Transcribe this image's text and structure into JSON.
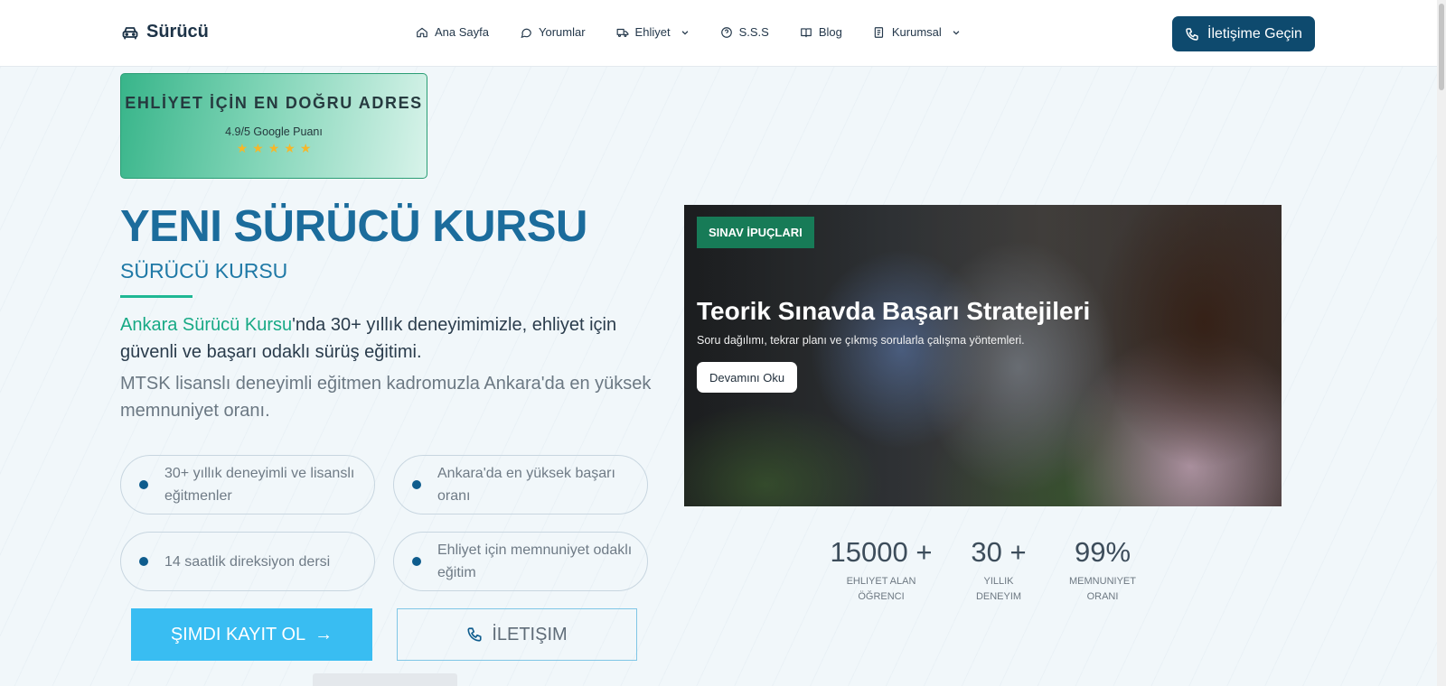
{
  "header": {
    "brand": "Sürücü",
    "nav": [
      {
        "label": "Ana Sayfa"
      },
      {
        "label": "Yorumlar"
      },
      {
        "label": "Ehliyet"
      },
      {
        "label": "S.S.S"
      },
      {
        "label": "Blog"
      },
      {
        "label": "Kurumsal"
      }
    ],
    "cta_label": "İletişime Geçin"
  },
  "badge": {
    "title": "EHLİYET İÇİN EN DOĞRU ADRES",
    "score": "4.9/5 Google Puanı",
    "stars": 5
  },
  "hero": {
    "title": "YENI SÜRÜCÜ KURSU",
    "subtitle": "SÜRÜCÜ KURSU",
    "p1_highlight": "Ankara Sürücü Kursu",
    "p1_rest": "'nda 30+ yıllık deneyimimizle, ehliyet için güvenli ve başarı odaklı sürüş eğitimi.",
    "p2": "MTSK lisanslı deneyimli eğitmen kadromuzla Ankara'da en yüksek memnuniyet oranı."
  },
  "features": [
    "30+ yıllık deneyimli ve lisanslı eğitmenler",
    "Ankara'da en yüksek başarı oranı",
    "14 saatlik direksiyon dersi",
    "Ehliyet için memnuniyet odaklı eğitim"
  ],
  "buttons": {
    "register": "ŞIMDI KAYIT OL",
    "contact": "İLETIŞIM"
  },
  "article": {
    "tag": "SINAV İPUÇLARI",
    "title": "Teorik Sınavda Başarı Stratejileri",
    "description": "Soru dağılımı, tekrar planı ve çıkmış sorularla çalışma yöntemleri.",
    "button": "Devamını Oku"
  },
  "stats": [
    {
      "value": "15000 +",
      "label_line1": "EHLIYET ALAN",
      "label_line2": "ÖĞRENCI"
    },
    {
      "value": "30 +",
      "label_line1": "YILLIK",
      "label_line2": "DENEYIM"
    },
    {
      "value": "99%",
      "label_line1": "MEMNUNIYET",
      "label_line2": "ORANI"
    }
  ],
  "colors": {
    "primary_dark": "#0e4a6e",
    "accent_green": "#17a985",
    "title_blue": "#1b6c9c",
    "button_sky": "#39bdf2",
    "star": "#f5b72a"
  }
}
